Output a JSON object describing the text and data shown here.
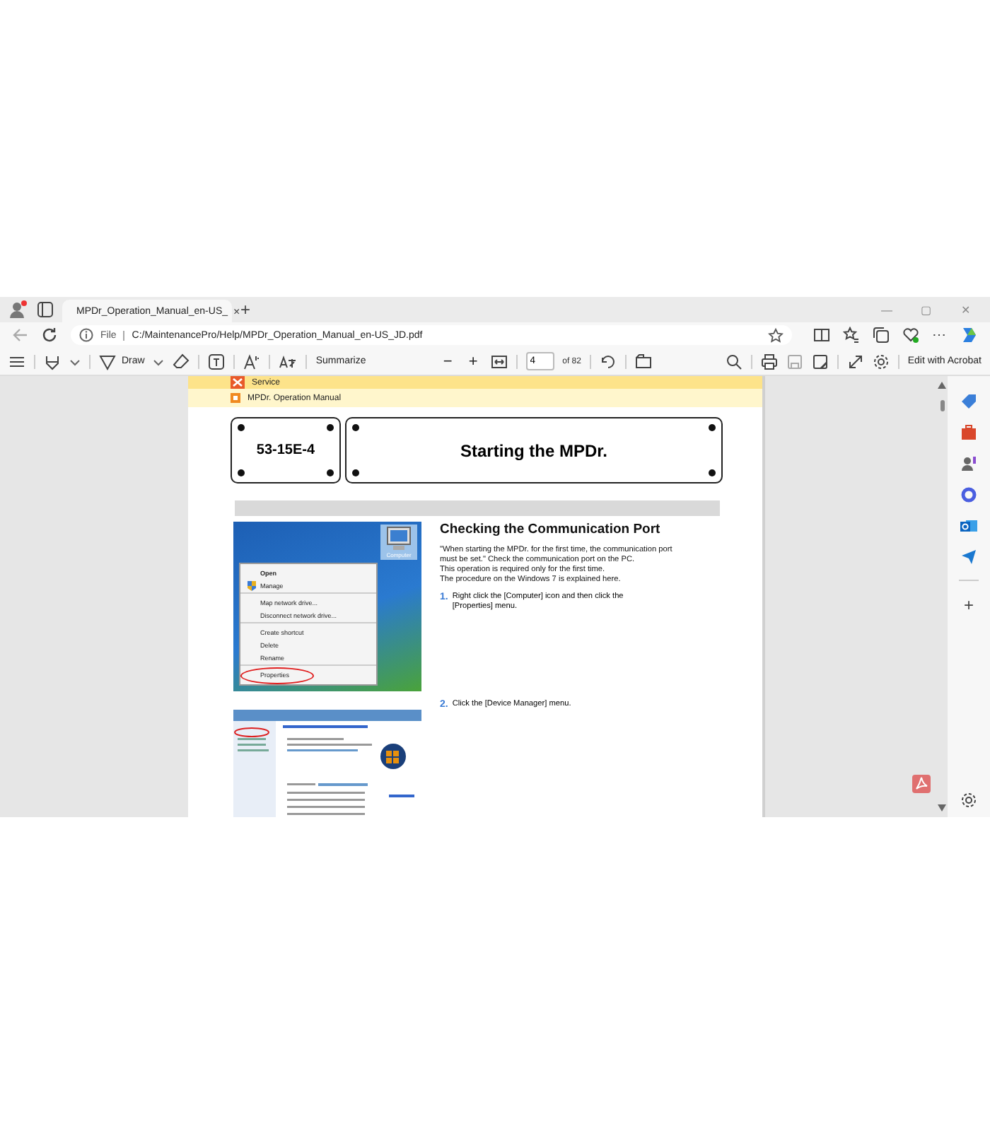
{
  "tab": {
    "title": "MPDr_Operation_Manual_en-US_",
    "close": "×",
    "new_tab": "+"
  },
  "address_bar": {
    "scheme": "File",
    "url": "C:/MaintenancePro/Help/MPDr_Operation_Manual_en-US_JD.pdf"
  },
  "window_controls": [
    "—",
    "▢",
    "✕"
  ],
  "more_menu": "⋯",
  "pdf_toolbar": {
    "draw": "Draw",
    "summarize": "Summarize",
    "zoom_out": "−",
    "zoom_in": "+",
    "page": "4",
    "page_count": "of 82",
    "edit": "Edit with Acrobat"
  },
  "document": {
    "breadcrumbs": [
      {
        "text": "Service",
        "kind": "service"
      },
      {
        "text": "MPDr. Operation Manual",
        "kind": "manual"
      }
    ],
    "section_code": "53-15E-4",
    "section_title": "Starting the MPDr.",
    "heading": "Checking the Communication Port",
    "intro": [
      "\"When starting the MPDr. for the first time, the communication port must be set.\" Check the communication port on the PC.",
      "This operation is required only for the first time.",
      "The procedure on the Windows 7 is explained here."
    ],
    "steps": [
      {
        "number": "1.",
        "text": "Right click the [Computer] icon and then click the [Properties] menu."
      },
      {
        "number": "2.",
        "text": "Click the [Device Manager] menu."
      }
    ],
    "screenshot_1": {
      "desktop_icon": "Computer",
      "menu": [
        {
          "text": "Open",
          "bold": true,
          "icon": false,
          "separator_after": false,
          "circled": false
        },
        {
          "text": "Manage",
          "bold": false,
          "icon": true,
          "separator_after": true,
          "circled": false
        },
        {
          "text": "Map network drive...",
          "bold": false,
          "icon": false,
          "separator_after": false,
          "circled": false
        },
        {
          "text": "Disconnect network drive...",
          "bold": false,
          "icon": false,
          "separator_after": true,
          "circled": false
        },
        {
          "text": "Create shortcut",
          "bold": false,
          "icon": false,
          "separator_after": false,
          "circled": false
        },
        {
          "text": "Delete",
          "bold": false,
          "icon": false,
          "separator_after": false,
          "circled": false
        },
        {
          "text": "Rename",
          "bold": false,
          "icon": false,
          "separator_after": true,
          "circled": false
        },
        {
          "text": "Properties",
          "bold": false,
          "icon": false,
          "separator_after": false,
          "circled": true
        }
      ]
    }
  }
}
